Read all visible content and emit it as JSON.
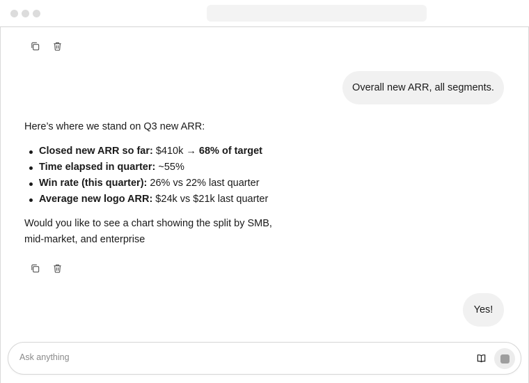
{
  "icons": {
    "copy": "copy-icon",
    "trash": "trash-icon",
    "book": "book-icon",
    "stop": "stop-square-icon"
  },
  "colors": {
    "bubble_bg": "#f1f1f1",
    "text": "#1a1a1a",
    "border": "#d6d6d6",
    "send_bg": "#ececec",
    "send_square": "#9e9e9e"
  },
  "messages": {
    "user_1": "Overall new ARR, all segments.",
    "assistant_intro": "Here’s where we stand on Q3 new ARR:",
    "bullets": [
      {
        "label": "Closed new ARR so far:",
        "value": " $410k → ",
        "strong": "68% of target"
      },
      {
        "label": "Time elapsed in quarter:",
        "value": " ~55%"
      },
      {
        "label": "Win rate (this quarter):",
        "value": " 26% vs 22% last quarter"
      },
      {
        "label": "Average new logo ARR:",
        "value": " $24k vs $21k last quarter"
      }
    ],
    "assistant_outro": "Would you like to see a chart showing the split by SMB, mid-market, and enterprise",
    "user_2": "Yes!"
  },
  "composer": {
    "placeholder": "Ask anything"
  }
}
